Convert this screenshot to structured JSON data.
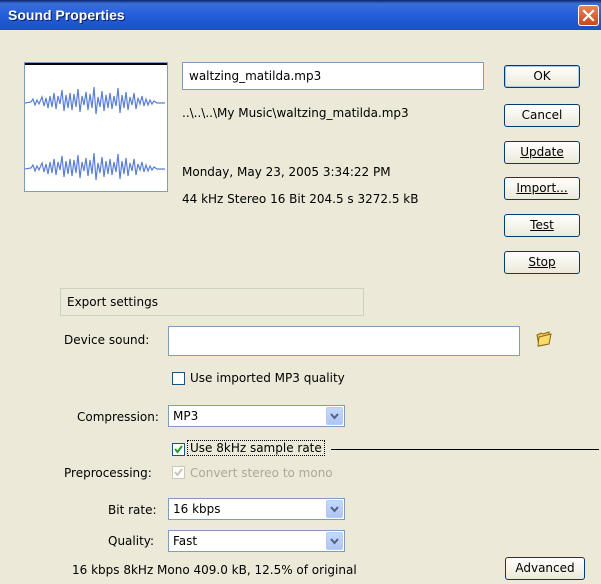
{
  "window": {
    "title": "Sound Properties"
  },
  "file": {
    "name": "waltzing_matilda.mp3",
    "path": "..\\..\\..\\My Music\\waltzing_matilda.mp3",
    "date": "Monday, May 23, 2005  3:34:22 PM",
    "info": "44 kHz Stereo 16 Bit 204.5 s 3272.5 kB"
  },
  "buttons": {
    "ok": "OK",
    "cancel": "Cancel",
    "update": "Update",
    "import": "Import...",
    "test": "Test",
    "stop": "Stop",
    "advanced": "Advanced"
  },
  "export": {
    "group_label": "Export settings",
    "device_sound_label": "Device sound:",
    "device_sound_value": "",
    "use_imported_mp3_label": "Use imported MP3 quality",
    "use_imported_mp3_checked": false,
    "compression_label": "Compression:",
    "compression_value": "MP3",
    "use_8khz_label": "Use 8kHz sample rate",
    "use_8khz_checked": true,
    "preprocessing_label": "Preprocessing:",
    "convert_stereo_label": "Convert stereo to mono",
    "convert_stereo_checked": true,
    "bitrate_label": "Bit rate:",
    "bitrate_value": "16 kbps",
    "quality_label": "Quality:",
    "quality_value": "Fast",
    "summary": "16 kbps 8kHz Mono 409.0 kB, 12.5% of original"
  },
  "colors": {
    "titlebar": "#245edb",
    "waveform": "#5a7fd6",
    "button_border": "#003c74",
    "check": "#21a121"
  },
  "icons": {
    "close": "close-icon",
    "folder": "folder-icon",
    "dropdown": "chevron-down-icon",
    "check": "checkmark-icon"
  }
}
